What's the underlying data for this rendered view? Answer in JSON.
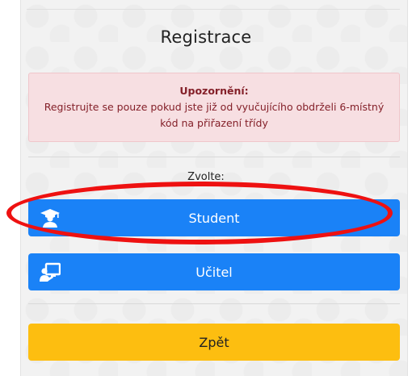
{
  "page": {
    "title": "Registrace"
  },
  "alert": {
    "title": "Upozornění:",
    "body": "Registrujte se pouze pokud jste již od vyučujícího obdrželi 6-místný kód na přiřazení třídy"
  },
  "choose_label": "Zvolte:",
  "buttons": {
    "student": {
      "label": "Student",
      "icon": "student-graduate-icon"
    },
    "teacher": {
      "label": "Učitel",
      "icon": "teacher-board-icon"
    },
    "back": {
      "label": "Zpět"
    }
  },
  "annotation": {
    "highlight_color": "#ee1111",
    "target": "student-button"
  },
  "colors": {
    "primary": "#1a82f7",
    "warning": "#fdbe10",
    "alert_bg": "#f7dfe2",
    "alert_text": "#842029"
  }
}
